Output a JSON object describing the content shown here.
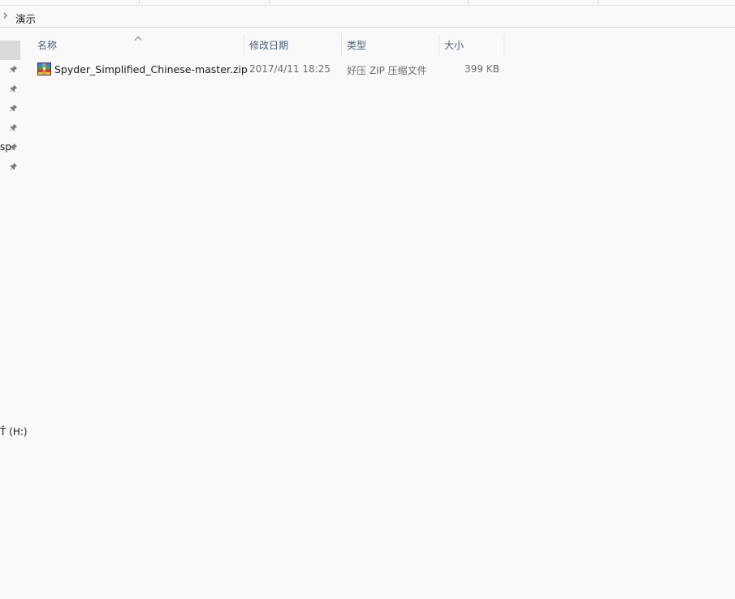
{
  "address_bar": {
    "crumbs": [
      "演示"
    ]
  },
  "navigation_pane": {
    "truncated_item_text": "sp",
    "drive_label": "(H:)",
    "drive_prefix": "Ť"
  },
  "columns": {
    "name": "名称",
    "modified": "修改日期",
    "type": "类型",
    "size": "大小",
    "sorted_by": "name",
    "sort_direction": "ascending"
  },
  "files": [
    {
      "name": "Spyder_Simplified_Chinese-master.zip",
      "modified": "2017/4/11 18:25",
      "type": "好压 ZIP 压缩文件",
      "size": "399 KB",
      "icon": "zip-archive-icon"
    }
  ],
  "colors": {
    "background": "#f9f9f9",
    "header_text": "#4c607a",
    "secondary_text": "#6d6d6d",
    "selection": "#d9d9d9"
  }
}
